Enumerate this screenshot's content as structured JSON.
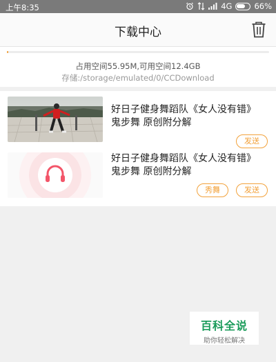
{
  "status_bar": {
    "time": "上午8:35",
    "network": "4G",
    "battery": "66%",
    "battery_level": 0.66
  },
  "header": {
    "title": "下载中心",
    "delete_icon": "trash-icon"
  },
  "storage": {
    "usage_text": "占用空间55.95M,可用空间12.4GB",
    "path_text": "存储:/storage/emulated/0/CCDownload",
    "used_fraction": 0.005
  },
  "downloads": [
    {
      "title": "好日子健身舞蹈队《女人没有错》鬼步舞 原创附分解",
      "thumbnail": "dance-video-thumbnail",
      "actions": [
        "发送"
      ]
    },
    {
      "title": "好日子健身舞蹈队《女人没有错》鬼步舞 原创附分解",
      "thumbnail": "headphones-audio-icon",
      "actions": [
        "秀舞",
        "发送"
      ]
    }
  ],
  "watermark": {
    "brand": "百科全说",
    "slogan": "助你轻松解决"
  },
  "colors": {
    "accent": "#f2a13a",
    "status_bar": "#7a7a7a",
    "watermark_green": "#1a9b5a"
  }
}
